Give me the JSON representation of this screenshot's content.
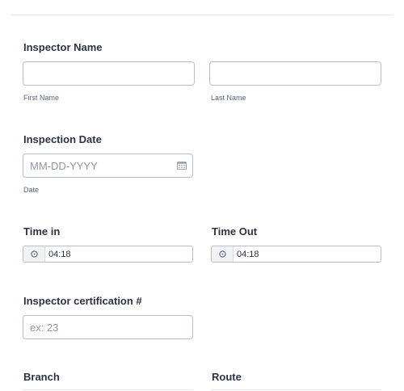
{
  "inspector_name": {
    "label": "Inspector Name",
    "first_name": {
      "value": "",
      "sublabel": "First Name"
    },
    "last_name": {
      "value": "",
      "sublabel": "Last Name"
    }
  },
  "inspection_date": {
    "label": "Inspection Date",
    "placeholder": "MM-DD-YYYY",
    "sublabel": "Date",
    "icon": "calendar-icon"
  },
  "time_in": {
    "label": "Time in",
    "value": "04:18",
    "icon": "clock-icon"
  },
  "time_out": {
    "label": "Time Out",
    "value": "04:18",
    "icon": "clock-icon"
  },
  "certification": {
    "label": "Inspector certification #",
    "placeholder": "ex: 23"
  },
  "branch": {
    "label": "Branch"
  },
  "route": {
    "label": "Route"
  }
}
